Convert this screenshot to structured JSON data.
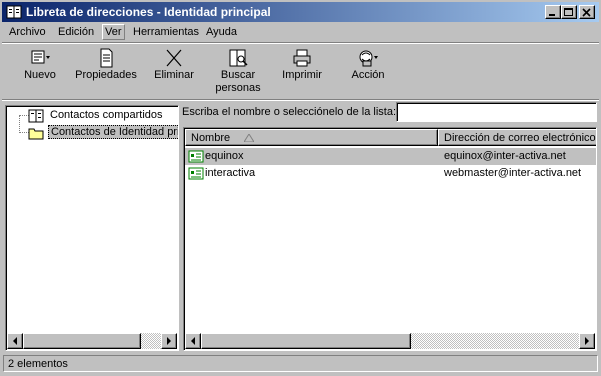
{
  "window": {
    "title": "Libreta de direcciones - Identidad principal",
    "buttons": [
      "minimize",
      "maximize",
      "close"
    ]
  },
  "menu": {
    "items": [
      {
        "label": "Archivo"
      },
      {
        "label": "Edición"
      },
      {
        "label": "Ver"
      },
      {
        "label": "Herramientas"
      },
      {
        "label": "Ayuda"
      }
    ],
    "active_index": 2
  },
  "toolbar": {
    "buttons": [
      {
        "label": "Nuevo",
        "icon": "new-contact-icon",
        "has_dropdown": true
      },
      {
        "label": "Propiedades",
        "icon": "properties-icon"
      },
      {
        "label": "Eliminar",
        "icon": "delete-x-icon"
      },
      {
        "label_line1": "Buscar",
        "label_line2": "personas",
        "icon": "find-people-icon"
      },
      {
        "label": "Imprimir",
        "icon": "printer-icon"
      },
      {
        "label": "Acción",
        "icon": "action-icon",
        "has_dropdown": true
      }
    ]
  },
  "tree": {
    "items": [
      {
        "label": "Contactos compartidos",
        "icon": "shared-contacts-icon",
        "selected": false
      },
      {
        "label": "Contactos de Identidad prir",
        "icon": "folder-icon",
        "selected": true
      }
    ]
  },
  "search": {
    "label": "Escriba el nombre o selecciónelo de la lista:",
    "value": ""
  },
  "list": {
    "columns": [
      {
        "label": "Nombre",
        "sort": "ascending"
      },
      {
        "label": "Dirección de correo electrónico"
      }
    ],
    "rows": [
      {
        "name": "equinox",
        "email": "equinox@inter-activa.net",
        "selected": true
      },
      {
        "name": "interactiva",
        "email": "webmaster@inter-activa.net",
        "selected": false
      }
    ]
  },
  "status": {
    "text": "2 elementos"
  },
  "colors": {
    "title_start": "#0a246a",
    "title_end": "#a6caf0",
    "face": "#c0c0c0"
  }
}
